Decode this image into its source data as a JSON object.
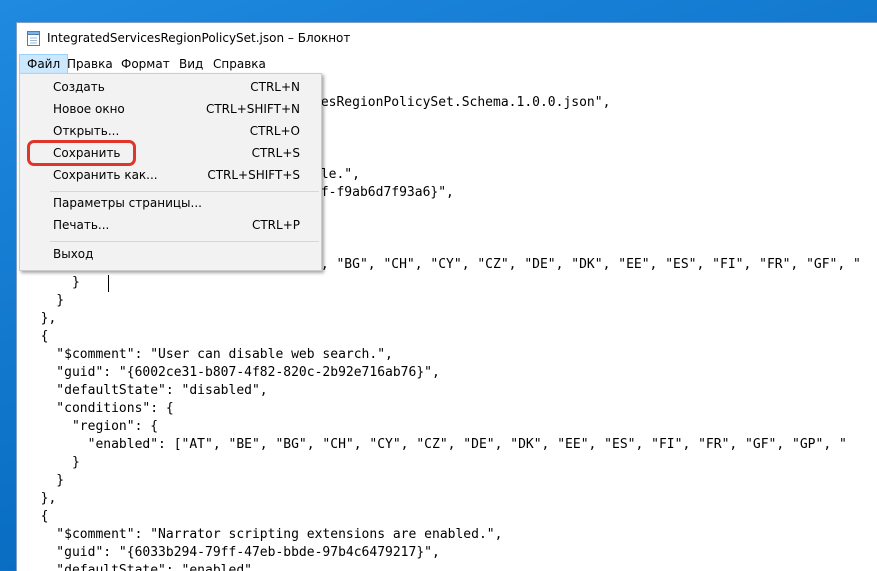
{
  "window": {
    "title": "IntegratedServicesRegionPolicySet.json – Блокнот",
    "icon": "notepad-icon"
  },
  "menubar": {
    "items": [
      "Файл",
      "Правка",
      "Формат",
      "Вид",
      "Справка"
    ],
    "active": "Файл"
  },
  "file_menu": {
    "items": [
      {
        "label": "Создать",
        "shortcut": "CTRL+N"
      },
      {
        "label": "Новое окно",
        "shortcut": "CTRL+SHIFT+N"
      },
      {
        "label": "Открыть...",
        "shortcut": "CTRL+O"
      },
      {
        "label": "Сохранить",
        "shortcut": "CTRL+S",
        "highlighted": true
      },
      {
        "label": "Сохранить как...",
        "shortcut": "CTRL+SHIFT+S"
      },
      {
        "label": "Параметры страницы...",
        "shortcut": ""
      },
      {
        "label": "Печать...",
        "shortcut": "CTRL+P"
      },
      {
        "label": "Выход",
        "shortcut": ""
      }
    ],
    "highlight_color": "#e0352b"
  },
  "editor": {
    "lines": [
      "cesRegionPolicySet.Schema.1.0.0.json\",",
      "",
      "",
      "",
      "ble.\",",
      "2f-f9ab6d7f93a6}\",",
      "",
      "",
      "\", \"BG\", \"CH\", \"CY\", \"CZ\", \"DE\", \"DK\", \"EE\", \"ES\", \"FI\", \"FR\", \"GF\", \"",
      "      }",
      "    }",
      "  },",
      "  {",
      "    \"$comment\": \"User can disable web search.\",",
      "    \"guid\": \"{6002ce31-b807-4f82-820c-2b92e716ab76}\",",
      "    \"defaultState\": \"disabled\",",
      "    \"conditions\": {",
      "      \"region\": {",
      "        \"enabled\": [\"AT\", \"BE\", \"BG\", \"CH\", \"CY\", \"CZ\", \"DE\", \"DK\", \"EE\", \"ES\", \"FI\", \"FR\", \"GF\", \"GP\", \"",
      "      }",
      "    }",
      "  },",
      "  {",
      "    \"$comment\": \"Narrator scripting extensions are enabled.\",",
      "    \"guid\": \"{6033b294-79ff-47eb-bbde-97b4c6479217}\",",
      "    \"defaultState\": \"enabled\""
    ]
  },
  "colors": {
    "desktop": "#0a72c8",
    "menu_active": "#cce8ff"
  }
}
